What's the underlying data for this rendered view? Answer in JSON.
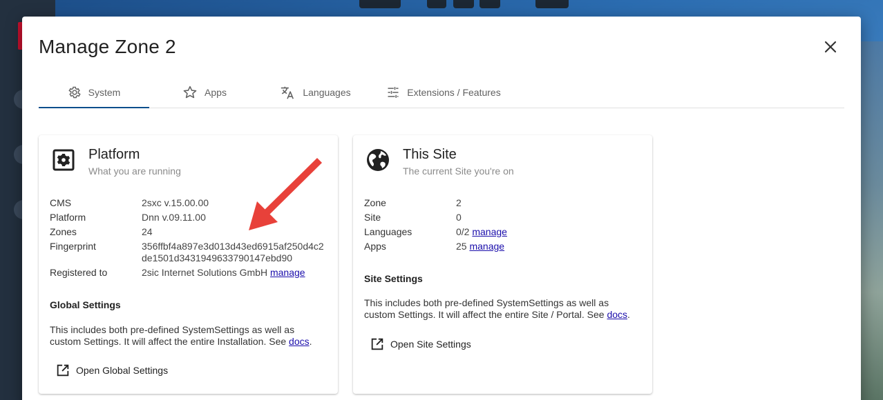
{
  "colors": {
    "accent": "#0b4e8c",
    "link": "#1a0dab",
    "arrow": "#e8413a"
  },
  "dialog": {
    "title": "Manage Zone 2",
    "close_icon": "close-icon"
  },
  "tabs": [
    {
      "label": "System",
      "icon": "gear-icon",
      "active": true
    },
    {
      "label": "Apps",
      "icon": "star-icon",
      "active": false
    },
    {
      "label": "Languages",
      "icon": "translate-icon",
      "active": false
    },
    {
      "label": "Extensions / Features",
      "icon": "tune-icon",
      "active": false
    }
  ],
  "platform": {
    "icon": "settings-box-icon",
    "title": "Platform",
    "subtitle": "What you are running",
    "cms_label": "CMS",
    "cms_value": "2sxc v.15.00.00",
    "platform_label": "Platform",
    "platform_value": "Dnn v.09.11.00",
    "zones_label": "Zones",
    "zones_value": "24",
    "fingerprint_label": "Fingerprint",
    "fingerprint_value": "356ffbf4a897e3d013d43ed6915af250d4c2de1501d3431949633790147ebd90",
    "registered_label": "Registered to",
    "registered_value": "2sic Internet Solutions GmbH",
    "registered_link": "manage",
    "global_title": "Global Settings",
    "global_text": "This includes both pre-defined SystemSettings as well as custom Settings. It will affect the entire Installation. See ",
    "global_link": "docs",
    "global_text_end": ".",
    "open_global": "Open Global Settings"
  },
  "site": {
    "icon": "globe-icon",
    "title": "This Site",
    "subtitle": "The current Site you're on",
    "zone_label": "Zone",
    "zone_value": "2",
    "site_label": "Site",
    "site_value": "0",
    "languages_label": "Languages",
    "languages_value": "0/2",
    "languages_link": "manage",
    "apps_label": "Apps",
    "apps_value": "25",
    "apps_link": "manage",
    "settings_title": "Site Settings",
    "settings_text": "This includes both pre-defined SystemSettings as well as custom Settings. It will affect the entire Site / Portal. See ",
    "settings_link": "docs",
    "settings_text_end": ".",
    "open_site": "Open Site Settings"
  }
}
